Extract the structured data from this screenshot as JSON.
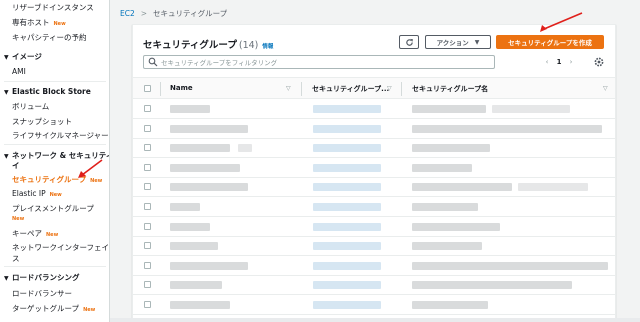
{
  "sidebar": {
    "items_top": [
      {
        "label": "リザーブドインスタンス",
        "new": ""
      },
      {
        "label": "専有ホスト",
        "new": "New"
      },
      {
        "label": "キャパシティーの予約",
        "new": ""
      }
    ],
    "sections": [
      {
        "title": "イメージ",
        "items": [
          {
            "label": "AMI",
            "new": ""
          }
        ]
      },
      {
        "title": "Elastic Block Store",
        "items": [
          {
            "label": "ボリューム",
            "new": ""
          },
          {
            "label": "スナップショット",
            "new": ""
          },
          {
            "label": "ライフサイクルマネージャー",
            "new": ""
          }
        ]
      },
      {
        "title": "ネットワーク & セキュリティ",
        "title2": "イ",
        "items": [
          {
            "label": "セキュリティグループ",
            "new": "New",
            "active": true
          },
          {
            "label": "Elastic IP",
            "new": "New"
          },
          {
            "label": "プレイスメントグループ",
            "new": "New"
          },
          {
            "label": "キーペア",
            "new": "New"
          },
          {
            "label": "ネットワークインターフェイ",
            "label2": "ス",
            "new": ""
          }
        ]
      },
      {
        "title": "ロードバランシング",
        "items": [
          {
            "label": "ロードバランサー",
            "new": ""
          },
          {
            "label": "ターゲットグループ",
            "new": "New"
          }
        ]
      }
    ]
  },
  "breadcrumb": {
    "root": "EC2",
    "current": "セキュリティグループ"
  },
  "panel": {
    "title": "セキュリティグループ",
    "count": "(14)",
    "info": "情報",
    "action_label": "アクション",
    "create_label": "セキュリティグループを作成",
    "search_placeholder": "セキュリティグループをフィルタリング",
    "page_current": "1"
  },
  "table": {
    "columns": [
      "Name",
      "セキュリティグループ...",
      "セキュリティグループ名"
    ],
    "row_count": 12
  },
  "colors": {
    "accent": "#ec7211",
    "link": "#0073bb",
    "annotation_arrow": "#e0201b"
  }
}
